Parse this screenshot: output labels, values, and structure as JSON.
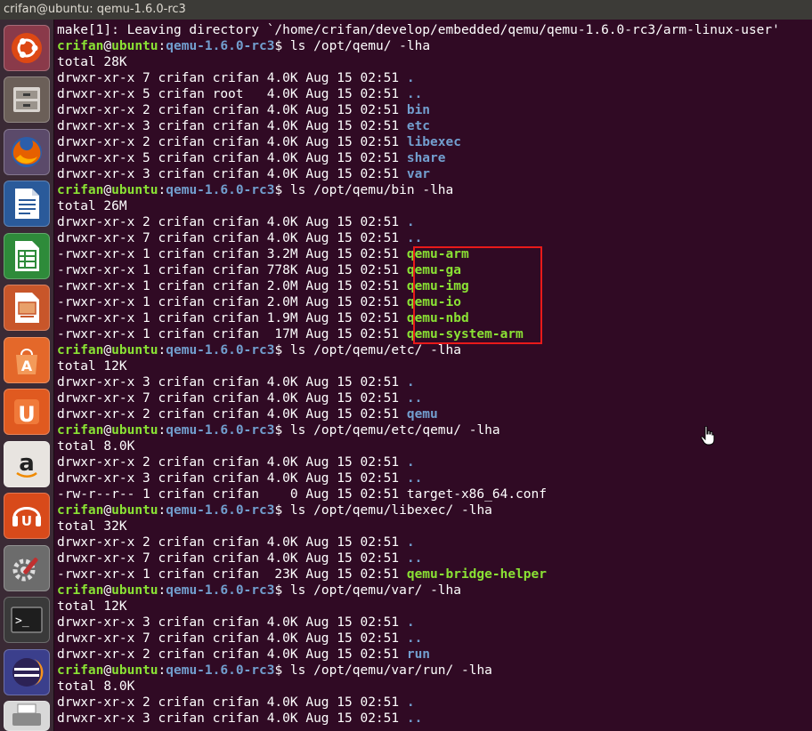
{
  "window": {
    "title": "crifan@ubuntu: qemu-1.6.0-rc3"
  },
  "launcher": {
    "items": [
      {
        "name": "dash-home-icon"
      },
      {
        "name": "files-icon"
      },
      {
        "name": "firefox-icon"
      },
      {
        "name": "writer-icon"
      },
      {
        "name": "calc-icon"
      },
      {
        "name": "impress-icon"
      },
      {
        "name": "software-center-icon"
      },
      {
        "name": "ubuntu-one-icon"
      },
      {
        "name": "amazon-icon",
        "glyph": "a"
      },
      {
        "name": "ubuntu-one-music-icon"
      },
      {
        "name": "system-settings-icon"
      },
      {
        "name": "terminal-icon",
        "glyph": ">_"
      },
      {
        "name": "eclipse-icon"
      },
      {
        "name": "printer-icon"
      }
    ]
  },
  "prompt": {
    "user": "crifan",
    "at": "@",
    "host": "ubuntu",
    "sep": ":",
    "path": "qemu-1.6.0-rc3",
    "sym": "$"
  },
  "lines": [
    {
      "t": "text",
      "text": "make[1]: Leaving directory `/home/crifan/develop/embedded/qemu/qemu-1.6.0-rc3/arm-linux-user'"
    },
    {
      "t": "cmd",
      "cmd": " ls /opt/qemu/ -lha"
    },
    {
      "t": "text",
      "text": "total 28K"
    },
    {
      "t": "ls",
      "prefix": "drwxr-xr-x 7 crifan crifan 4.0K Aug 15 02:51 ",
      "name": ".",
      "k": "d"
    },
    {
      "t": "ls",
      "prefix": "drwxr-xr-x 5 crifan root   4.0K Aug 15 02:51 ",
      "name": "..",
      "k": "d"
    },
    {
      "t": "ls",
      "prefix": "drwxr-xr-x 2 crifan crifan 4.0K Aug 15 02:51 ",
      "name": "bin",
      "k": "d"
    },
    {
      "t": "ls",
      "prefix": "drwxr-xr-x 3 crifan crifan 4.0K Aug 15 02:51 ",
      "name": "etc",
      "k": "d"
    },
    {
      "t": "ls",
      "prefix": "drwxr-xr-x 2 crifan crifan 4.0K Aug 15 02:51 ",
      "name": "libexec",
      "k": "d"
    },
    {
      "t": "ls",
      "prefix": "drwxr-xr-x 5 crifan crifan 4.0K Aug 15 02:51 ",
      "name": "share",
      "k": "d"
    },
    {
      "t": "ls",
      "prefix": "drwxr-xr-x 3 crifan crifan 4.0K Aug 15 02:51 ",
      "name": "var",
      "k": "d"
    },
    {
      "t": "cmd",
      "cmd": " ls /opt/qemu/bin -lha"
    },
    {
      "t": "text",
      "text": "total 26M"
    },
    {
      "t": "ls",
      "prefix": "drwxr-xr-x 2 crifan crifan 4.0K Aug 15 02:51 ",
      "name": ".",
      "k": "d"
    },
    {
      "t": "ls",
      "prefix": "drwxr-xr-x 7 crifan crifan 4.0K Aug 15 02:51 ",
      "name": "..",
      "k": "d"
    },
    {
      "t": "ls",
      "prefix": "-rwxr-xr-x 1 crifan crifan 3.2M Aug 15 02:51 ",
      "name": "qemu-arm",
      "k": "x"
    },
    {
      "t": "ls",
      "prefix": "-rwxr-xr-x 1 crifan crifan 778K Aug 15 02:51 ",
      "name": "qemu-ga",
      "k": "x"
    },
    {
      "t": "ls",
      "prefix": "-rwxr-xr-x 1 crifan crifan 2.0M Aug 15 02:51 ",
      "name": "qemu-img",
      "k": "x"
    },
    {
      "t": "ls",
      "prefix": "-rwxr-xr-x 1 crifan crifan 2.0M Aug 15 02:51 ",
      "name": "qemu-io",
      "k": "x"
    },
    {
      "t": "ls",
      "prefix": "-rwxr-xr-x 1 crifan crifan 1.9M Aug 15 02:51 ",
      "name": "qemu-nbd",
      "k": "x"
    },
    {
      "t": "ls",
      "prefix": "-rwxr-xr-x 1 crifan crifan  17M Aug 15 02:51 ",
      "name": "qemu-system-arm",
      "k": "x"
    },
    {
      "t": "cmd",
      "cmd": " ls /opt/qemu/etc/ -lha"
    },
    {
      "t": "text",
      "text": "total 12K"
    },
    {
      "t": "ls",
      "prefix": "drwxr-xr-x 3 crifan crifan 4.0K Aug 15 02:51 ",
      "name": ".",
      "k": "d"
    },
    {
      "t": "ls",
      "prefix": "drwxr-xr-x 7 crifan crifan 4.0K Aug 15 02:51 ",
      "name": "..",
      "k": "d"
    },
    {
      "t": "ls",
      "prefix": "drwxr-xr-x 2 crifan crifan 4.0K Aug 15 02:51 ",
      "name": "qemu",
      "k": "d"
    },
    {
      "t": "cmd",
      "cmd": " ls /opt/qemu/etc/qemu/ -lha"
    },
    {
      "t": "text",
      "text": "total 8.0K"
    },
    {
      "t": "ls",
      "prefix": "drwxr-xr-x 2 crifan crifan 4.0K Aug 15 02:51 ",
      "name": ".",
      "k": "d"
    },
    {
      "t": "ls",
      "prefix": "drwxr-xr-x 3 crifan crifan 4.0K Aug 15 02:51 ",
      "name": "..",
      "k": "d"
    },
    {
      "t": "ls",
      "prefix": "-rw-r--r-- 1 crifan crifan    0 Aug 15 02:51 ",
      "name": "target-x86_64.conf",
      "k": "f"
    },
    {
      "t": "cmd",
      "cmd": " ls /opt/qemu/libexec/ -lha"
    },
    {
      "t": "text",
      "text": "total 32K"
    },
    {
      "t": "ls",
      "prefix": "drwxr-xr-x 2 crifan crifan 4.0K Aug 15 02:51 ",
      "name": ".",
      "k": "d"
    },
    {
      "t": "ls",
      "prefix": "drwxr-xr-x 7 crifan crifan 4.0K Aug 15 02:51 ",
      "name": "..",
      "k": "d"
    },
    {
      "t": "ls",
      "prefix": "-rwxr-xr-x 1 crifan crifan  23K Aug 15 02:51 ",
      "name": "qemu-bridge-helper",
      "k": "x"
    },
    {
      "t": "cmd",
      "cmd": " ls /opt/qemu/var/ -lha"
    },
    {
      "t": "text",
      "text": "total 12K"
    },
    {
      "t": "ls",
      "prefix": "drwxr-xr-x 3 crifan crifan 4.0K Aug 15 02:51 ",
      "name": ".",
      "k": "d"
    },
    {
      "t": "ls",
      "prefix": "drwxr-xr-x 7 crifan crifan 4.0K Aug 15 02:51 ",
      "name": "..",
      "k": "d"
    },
    {
      "t": "ls",
      "prefix": "drwxr-xr-x 2 crifan crifan 4.0K Aug 15 02:51 ",
      "name": "run",
      "k": "d"
    },
    {
      "t": "cmd",
      "cmd": " ls /opt/qemu/var/run/ -lha"
    },
    {
      "t": "text",
      "text": "total 8.0K"
    },
    {
      "t": "ls",
      "prefix": "drwxr-xr-x 2 crifan crifan 4.0K Aug 15 02:51 ",
      "name": ".",
      "k": "d"
    },
    {
      "t": "ls",
      "prefix": "drwxr-xr-x 3 crifan crifan 4.0K Aug 15 02:51 ",
      "name": "..",
      "k": "d"
    }
  ],
  "colors": {
    "background": "#300a24",
    "user_host": "#8ae234",
    "path": "#729fcf",
    "dir": "#729fcf",
    "exec": "#8ae234",
    "highlight": "#e81a1a"
  }
}
